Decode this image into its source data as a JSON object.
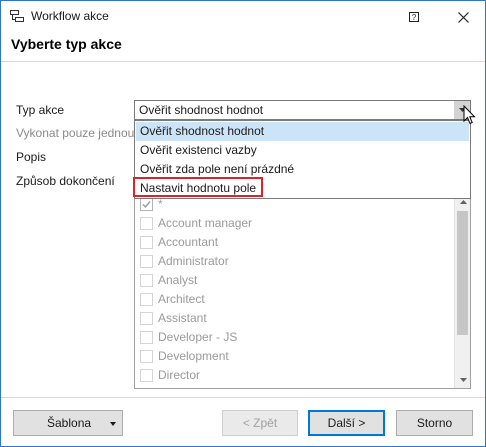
{
  "window": {
    "title": "Workflow akce",
    "help_icon": "help-icon",
    "close_icon": "close-icon"
  },
  "heading": "Vyberte typ akce",
  "form": {
    "action_type_label": "Typ akce",
    "execute_once_label": "Vykonat pouze jednou",
    "description_label": "Popis",
    "completion_label": "Způsob dokončení",
    "action_type_value": "Ověřit shodnost hodnot"
  },
  "dropdown": {
    "options": [
      "Ověřit shodnost hodnot",
      "Ověřit existenci vazby",
      "Ověřit zda pole není prázdné",
      "Nastavit hodnotu pole"
    ],
    "selected_index": 0,
    "highlighted_index": 3,
    "highlight_color": "#d7262b",
    "selection_color": "#cce4f7"
  },
  "roles_list": {
    "items": [
      {
        "label": "*",
        "checked": true
      },
      {
        "label": "Account manager",
        "checked": false
      },
      {
        "label": "Accountant",
        "checked": false
      },
      {
        "label": "Administrator",
        "checked": false
      },
      {
        "label": "Analyst",
        "checked": false
      },
      {
        "label": "Architect",
        "checked": false
      },
      {
        "label": "Assistant",
        "checked": false
      },
      {
        "label": "Developer - JS",
        "checked": false
      },
      {
        "label": "Development",
        "checked": false
      },
      {
        "label": "Director",
        "checked": false
      }
    ]
  },
  "buttons": {
    "template": "Šablona",
    "back": "< Zpět",
    "next": "Další >",
    "cancel": "Storno"
  },
  "colors": {
    "accent": "#0078d7",
    "window_border": "#2b78c9"
  }
}
